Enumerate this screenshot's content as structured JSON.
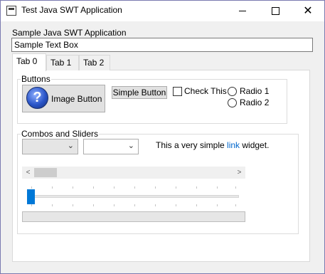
{
  "window": {
    "title": "Test Java SWT Application",
    "controls": {
      "minimize_icon": "minimize-icon",
      "maximize_icon": "maximize-icon",
      "close_icon": "close-icon",
      "close_glyph": "✕"
    }
  },
  "app": {
    "label": "Sample Java SWT Application",
    "textbox_value": "Sample Text Box"
  },
  "tabs": [
    {
      "label": "Tab 0",
      "active": true
    },
    {
      "label": "Tab 1",
      "active": false
    },
    {
      "label": "Tab 2",
      "active": false
    }
  ],
  "buttons_group": {
    "title": "Buttons",
    "image_button": {
      "label": "Image Button",
      "icon": "help-icon",
      "glyph": "?"
    },
    "simple_button": {
      "label": "Simple Button"
    },
    "checkbox": {
      "label": "Check This",
      "checked": false
    },
    "radios": [
      {
        "label": "Radio 1",
        "selected": false
      },
      {
        "label": "Radio 2",
        "selected": false
      }
    ]
  },
  "combos_group": {
    "title": "Combos and Sliders",
    "combo1": {
      "value": "",
      "arrow": "⌄"
    },
    "combo2": {
      "value": "",
      "arrow": "⌄"
    },
    "link_text": {
      "before": "This a very simple ",
      "link": "link",
      "after": " widget."
    },
    "scrollbar": {
      "left_arrow": "<",
      "right_arrow": ">"
    },
    "slider": {
      "value": 0
    },
    "progress": {
      "value": 0
    }
  },
  "colors": {
    "accent": "#0078d7",
    "link": "#0066cc",
    "button_face": "#e1e1e1",
    "panel": "#ffffff",
    "window_bg": "#f0f0f0"
  }
}
